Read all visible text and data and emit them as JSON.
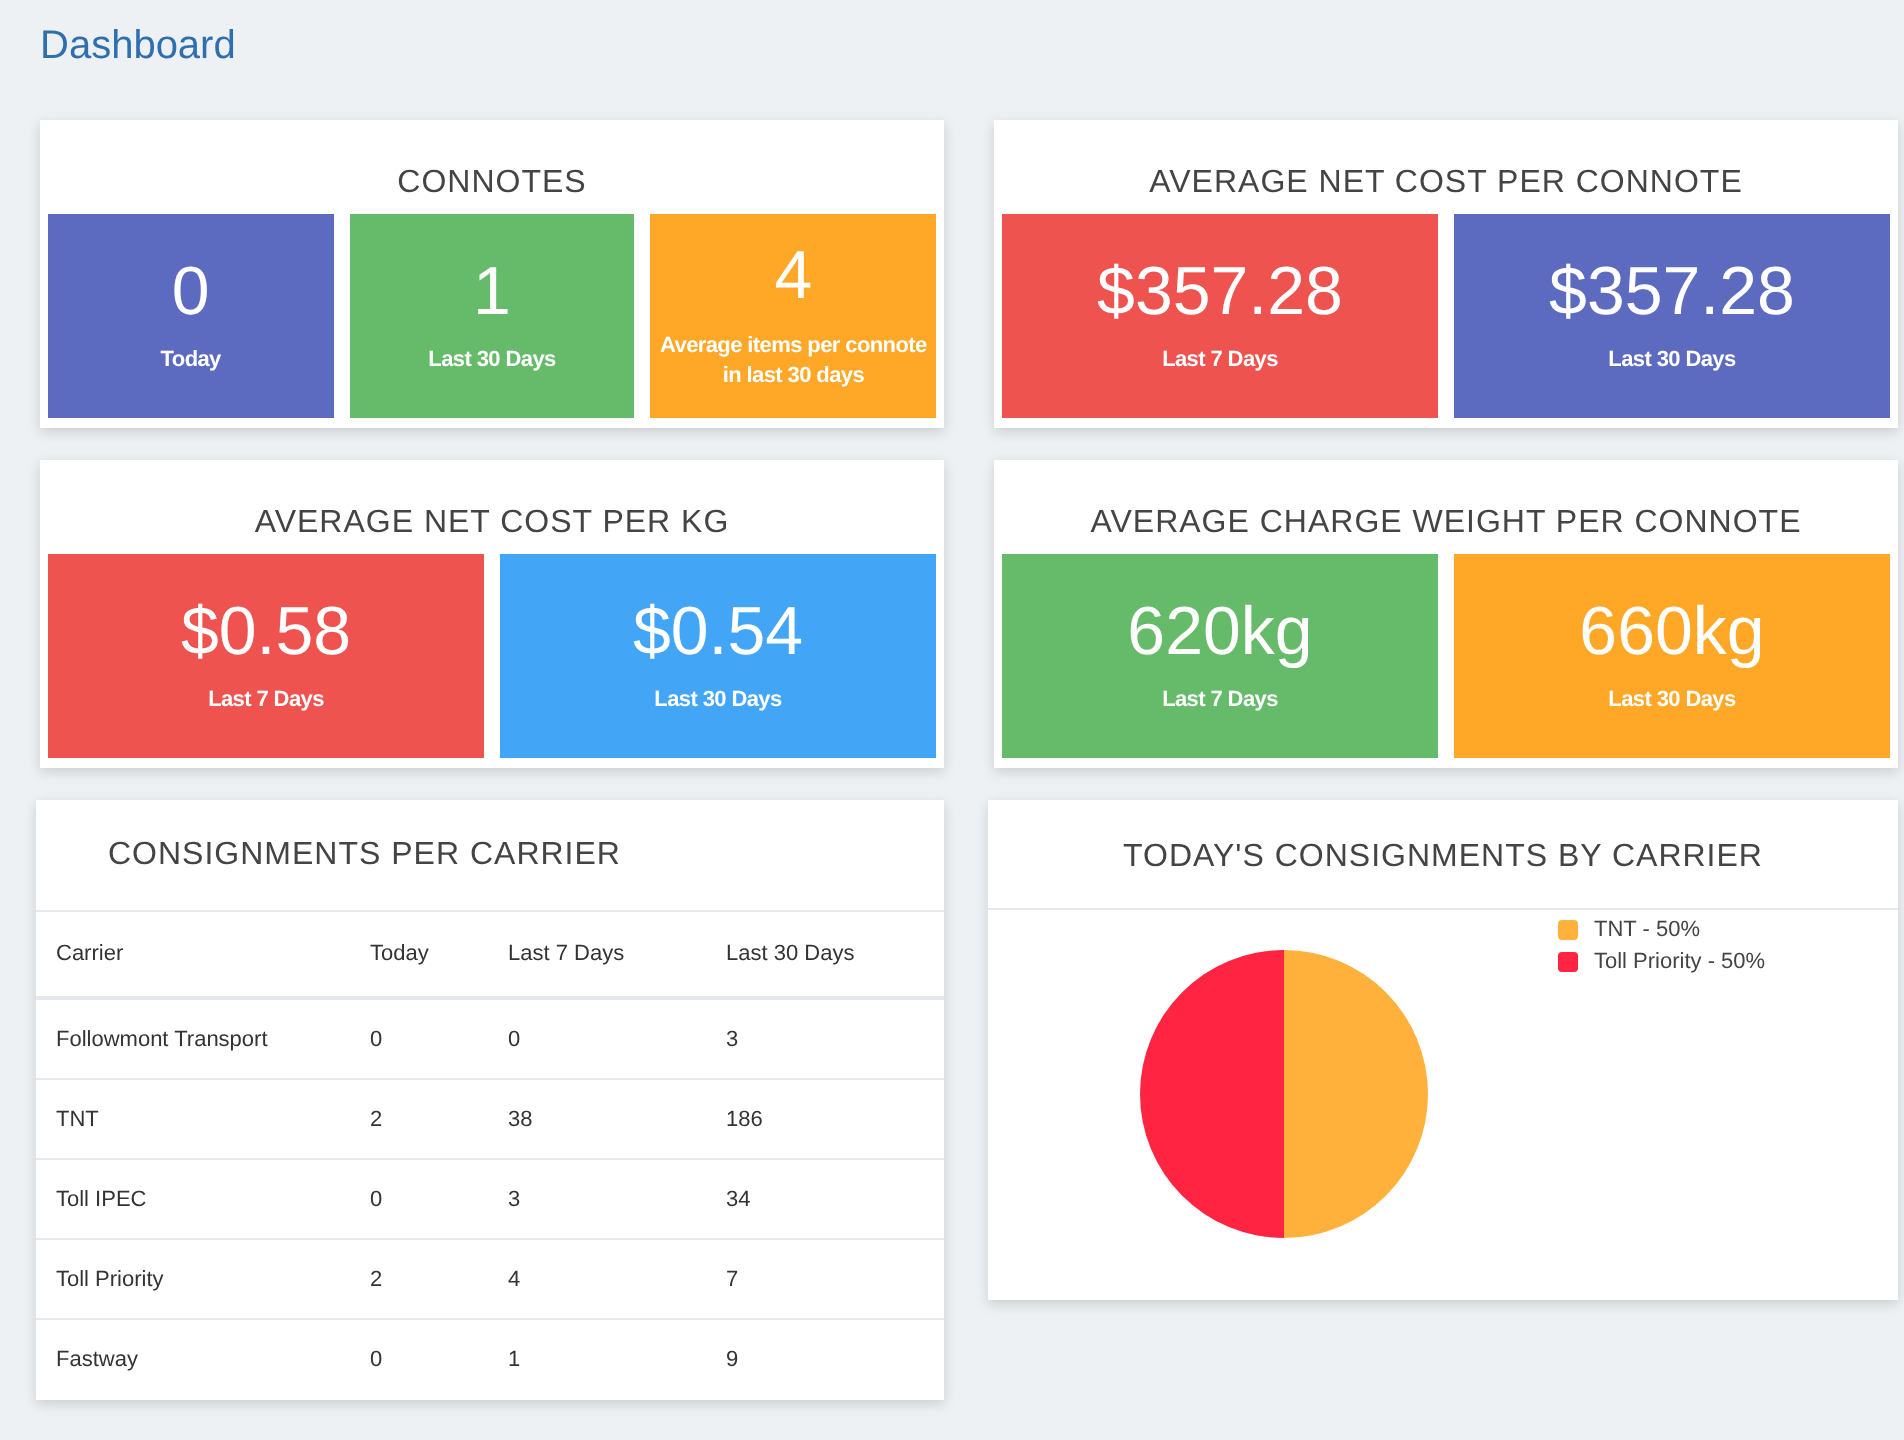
{
  "page_title": "Dashboard",
  "stat_cards": [
    {
      "title": "CONNOTES",
      "tiles": [
        {
          "value": "0",
          "label": "Today",
          "color": "#5c6bc0"
        },
        {
          "value": "1",
          "label": "Last 30 Days",
          "color": "#66bb6a"
        },
        {
          "value": "4",
          "label": "Average items per connote in last 30 days",
          "color": "#ffa726"
        }
      ]
    },
    {
      "title": "AVERAGE NET COST PER CONNOTE",
      "tiles": [
        {
          "value": "$357.28",
          "label": "Last 7 Days",
          "color": "#ef5350"
        },
        {
          "value": "$357.28",
          "label": "Last 30 Days",
          "color": "#5c6bc0"
        }
      ]
    },
    {
      "title": "AVERAGE NET COST PER KG",
      "tiles": [
        {
          "value": "$0.58",
          "label": "Last 7 Days",
          "color": "#ef5350"
        },
        {
          "value": "$0.54",
          "label": "Last 30 Days",
          "color": "#42a5f5"
        }
      ]
    },
    {
      "title": "AVERAGE CHARGE WEIGHT PER CONNOTE",
      "tiles": [
        {
          "value": "620kg",
          "label": "Last 7 Days",
          "color": "#66bb6a"
        },
        {
          "value": "660kg",
          "label": "Last 30 Days",
          "color": "#ffa726"
        }
      ]
    }
  ],
  "carrier_table": {
    "title": "CONSIGNMENTS PER CARRIER",
    "columns": [
      "Carrier",
      "Today",
      "Last 7 Days",
      "Last 30 Days"
    ],
    "rows": [
      [
        "Followmont Transport",
        "0",
        "0",
        "3"
      ],
      [
        "TNT",
        "2",
        "38",
        "186"
      ],
      [
        "Toll IPEC",
        "0",
        "3",
        "34"
      ],
      [
        "Toll Priority",
        "2",
        "4",
        "7"
      ],
      [
        "Fastway",
        "0",
        "1",
        "9"
      ]
    ]
  },
  "pie_card": {
    "title": "TODAY'S CONSIGNMENTS BY CARRIER",
    "legend": [
      {
        "label": "TNT - 50%",
        "color": "#ffb13b"
      },
      {
        "label": "Toll Priority - 50%",
        "color": "#ff2442"
      }
    ],
    "chart_data": {
      "type": "pie",
      "values": [
        50,
        50
      ]
    }
  }
}
